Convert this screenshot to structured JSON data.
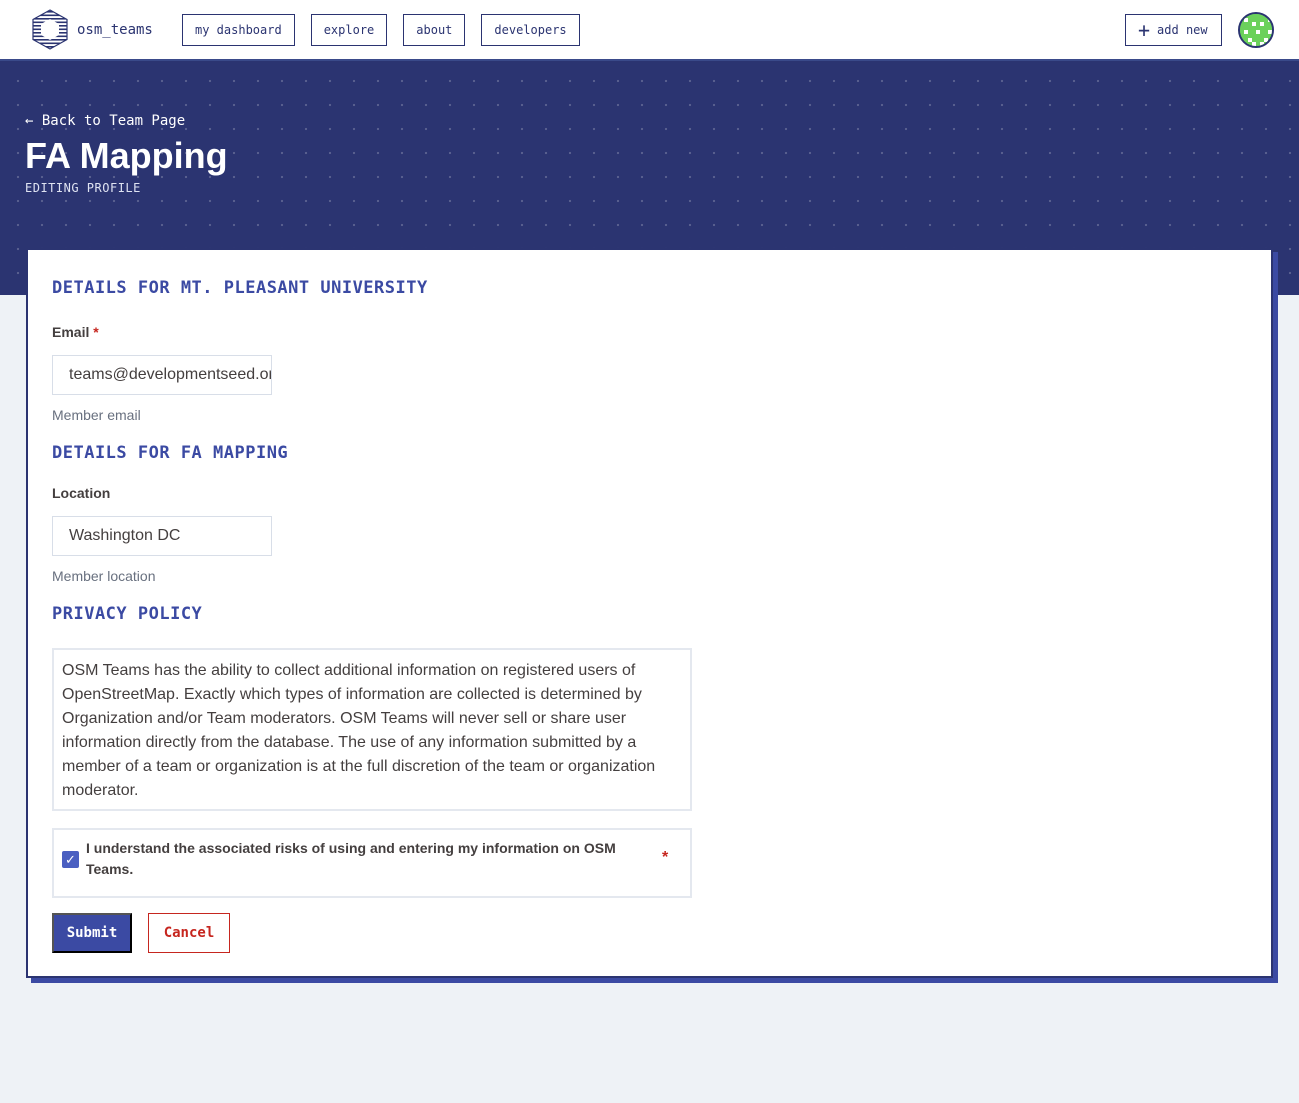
{
  "nav": {
    "brand": "osm_teams",
    "links": [
      "my dashboard",
      "explore",
      "about",
      "developers"
    ],
    "add_new": "add new"
  },
  "hero": {
    "back": "← Back to Team Page",
    "title": "FA Mapping",
    "subtitle": "EDITING PROFILE"
  },
  "form": {
    "org_section": "DETAILS FOR MT. PLEASANT UNIVERSITY",
    "email_label": "Email",
    "email_value": "teams@developmentseed.org",
    "email_help": "Member email",
    "team_section": "DETAILS FOR FA MAPPING",
    "location_label": "Location",
    "location_value": "Washington DC",
    "location_help": "Member location",
    "privacy_section": "PRIVACY POLICY",
    "privacy_text": "OSM Teams has the ability to collect additional information on registered users of OpenStreetMap. Exactly which types of information are collected is determined by Organization and/or Team moderators. OSM Teams will never sell or share user information directly from the database. The use of any information submitted by a member of a team or organization is at the full discretion of the team or organization moderator.",
    "consent_text": "I understand the associated risks of using and entering my information on OSM Teams.",
    "consent_checked": true,
    "required_mark": "*",
    "submit": "Submit",
    "cancel": "Cancel"
  },
  "colors": {
    "primary": "#2b3471",
    "accent": "#3b4aa3",
    "danger": "#c6261f",
    "background": "#eef2f6"
  },
  "icons": [
    "osm-teams-logo-icon",
    "plus-icon",
    "avatar-icon",
    "checkmark-icon"
  ]
}
